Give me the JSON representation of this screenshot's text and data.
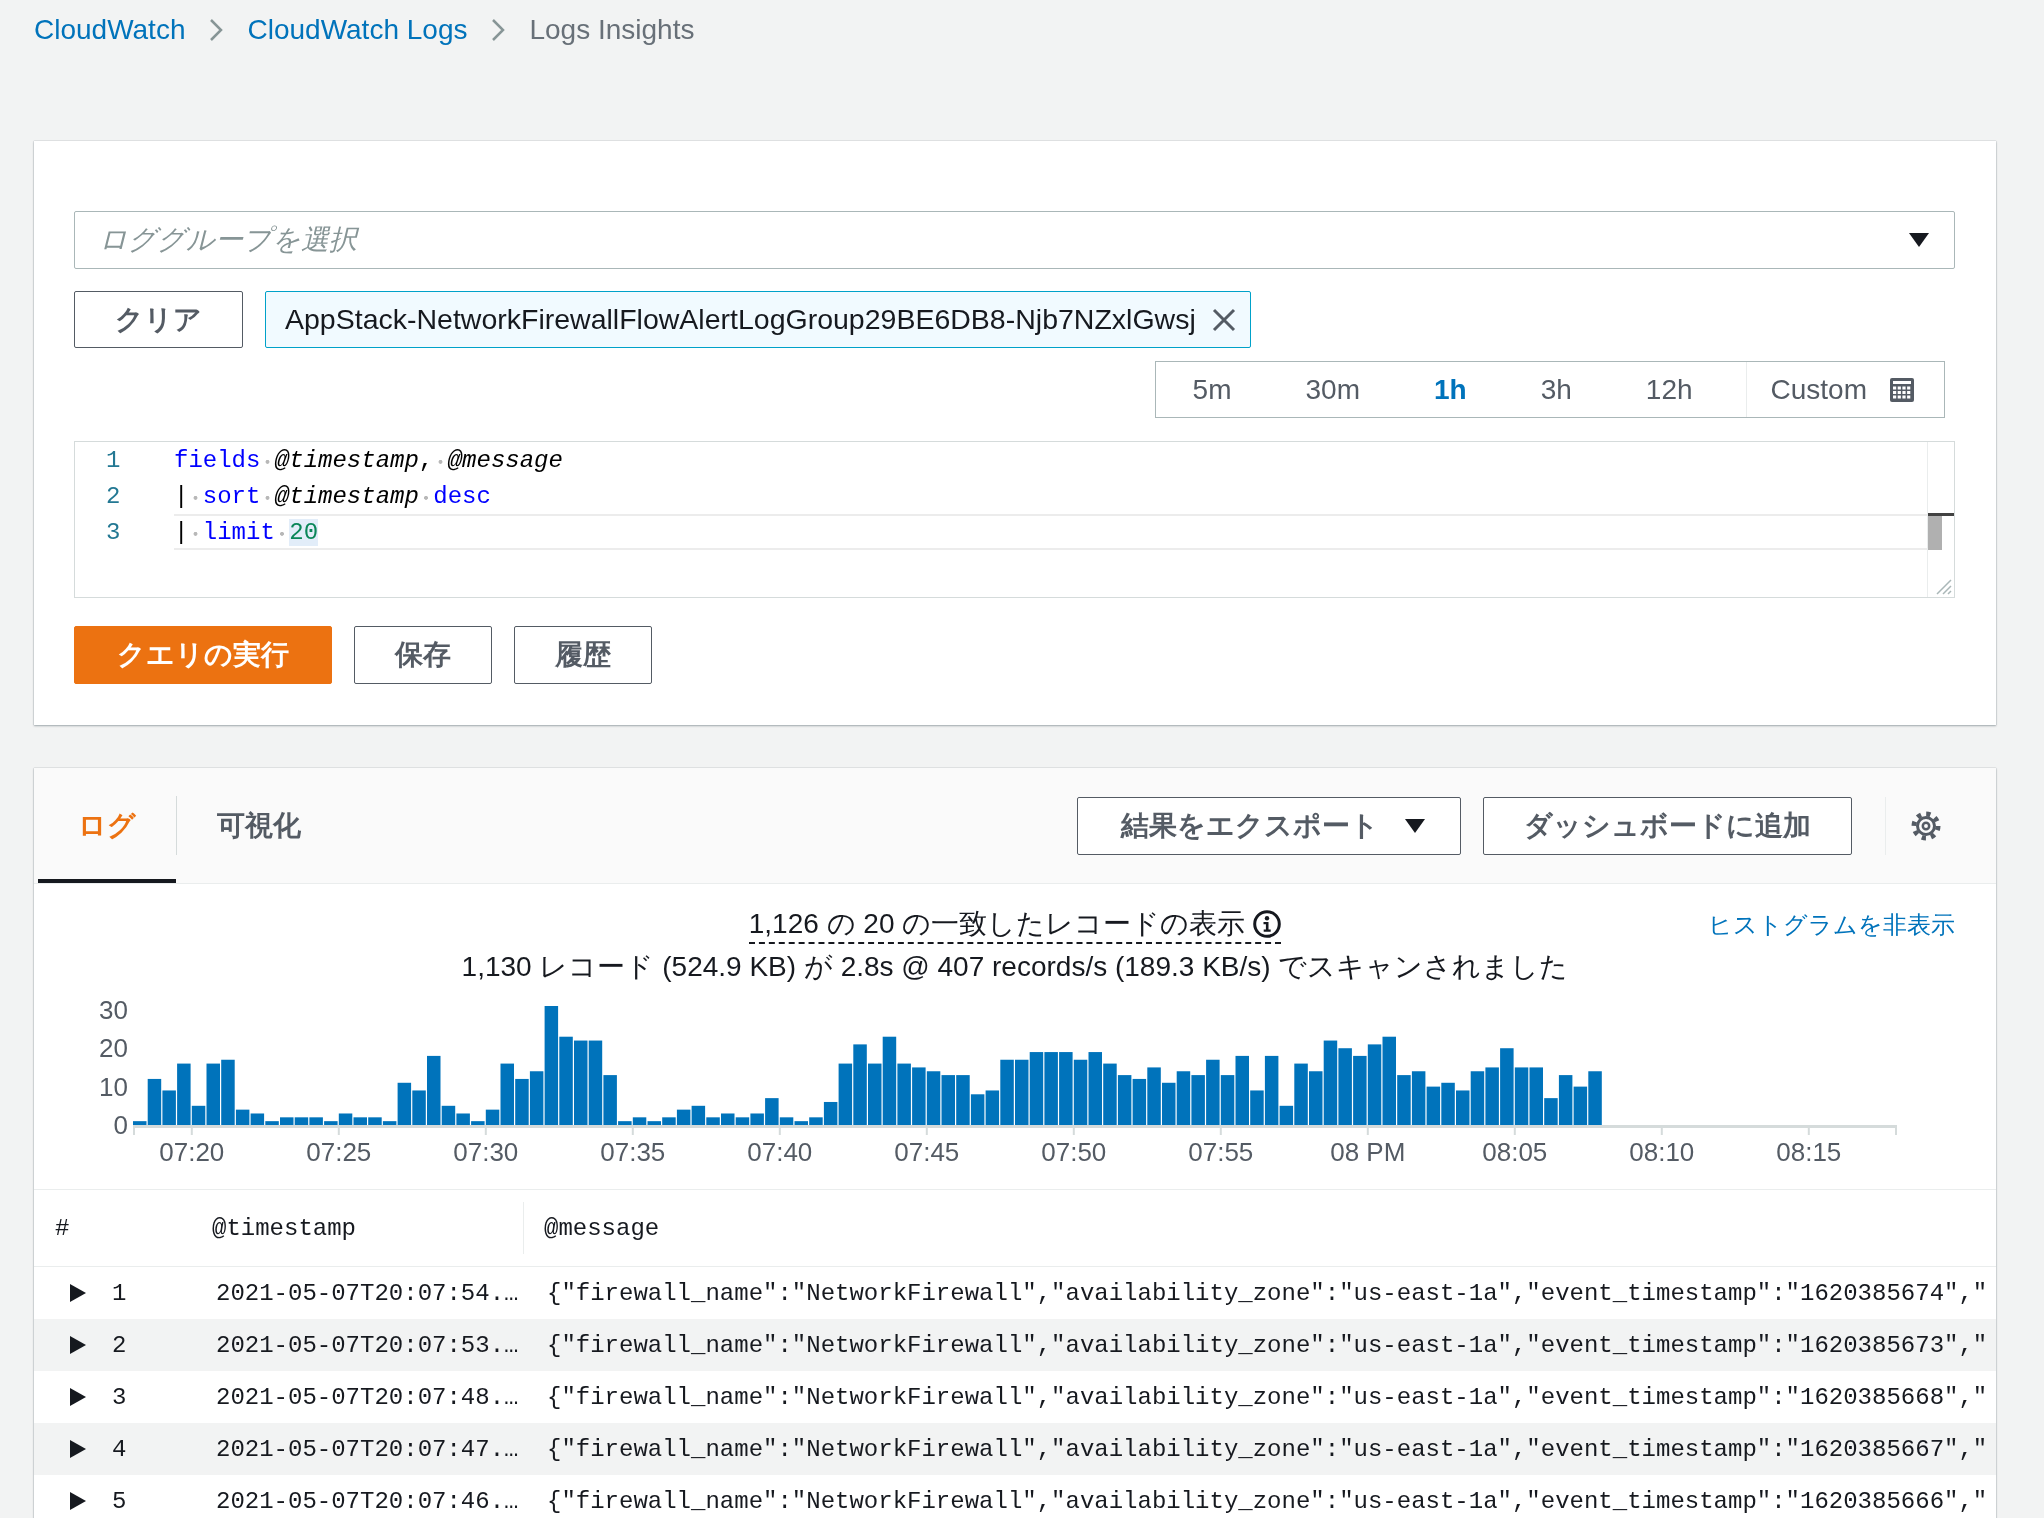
{
  "breadcrumb": [
    {
      "label": "CloudWatch",
      "kind": "link"
    },
    {
      "label": "CloudWatch Logs",
      "kind": "link"
    },
    {
      "label": "Logs Insights",
      "kind": "current"
    }
  ],
  "query_panel": {
    "log_group_select": {
      "placeholder": "ロググループを選択"
    },
    "clear_button": "クリア",
    "selected_log_groups": [
      "AppStack-NetworkFirewallFlowAlertLogGroup29BE6DB8-Njb7NZxlGwsj"
    ],
    "time_ranges": [
      {
        "label": "5m",
        "selected": false
      },
      {
        "label": "30m",
        "selected": false
      },
      {
        "label": "1h",
        "selected": true
      },
      {
        "label": "3h",
        "selected": false
      },
      {
        "label": "12h",
        "selected": false
      }
    ],
    "custom_range": {
      "label": "Custom"
    },
    "editor": {
      "lines": [
        {
          "number": "1",
          "active": false,
          "tokens": [
            {
              "kind": "keyword",
              "text": "fields ",
              "highlighted": false
            },
            {
              "kind": "field",
              "text": "@timestamp",
              "highlighted": false
            },
            {
              "kind": "punct",
              "text": ", ",
              "highlighted": false
            },
            {
              "kind": "field",
              "text": "@message",
              "highlighted": false
            }
          ]
        },
        {
          "number": "2",
          "active": false,
          "tokens": [
            {
              "kind": "punct",
              "text": "| ",
              "highlighted": false
            },
            {
              "kind": "keyword",
              "text": "sort ",
              "highlighted": false
            },
            {
              "kind": "field",
              "text": "@timestamp ",
              "highlighted": false
            },
            {
              "kind": "keyword",
              "text": "desc",
              "highlighted": false
            }
          ]
        },
        {
          "number": "3",
          "active": true,
          "tokens": [
            {
              "kind": "punct",
              "text": "| ",
              "highlighted": false
            },
            {
              "kind": "keyword",
              "text": "limit ",
              "highlighted": false
            },
            {
              "kind": "number",
              "text": "20",
              "highlighted": true
            }
          ]
        }
      ]
    },
    "buttons": [
      {
        "label": "クエリの実行",
        "kind": "primary"
      },
      {
        "label": "保存",
        "kind": "normal"
      },
      {
        "label": "履歴",
        "kind": "normal"
      }
    ]
  },
  "results_panel": {
    "tabs": [
      {
        "label": "ログ",
        "selected": true
      },
      {
        "label": "可視化",
        "selected": false
      }
    ],
    "export_button": "結果をエクスポート",
    "dashboard_button": "ダッシュボードに追加",
    "summary": "1,126 の 20 の一致したレコードの表示",
    "hide_histogram_link": "ヒストグラムを非表示",
    "scan_stats": "1,130 レコード (524.9 KB) が 2.8s @ 407 records/s (189.3 KB/s) でスキャンされました",
    "chart_data": {
      "type": "bar",
      "categories": [
        null,
        null,
        null,
        null,
        "07:20",
        null,
        null,
        null,
        null,
        null,
        null,
        null,
        null,
        null,
        "07:25",
        null,
        null,
        null,
        null,
        null,
        null,
        null,
        null,
        null,
        "07:30",
        null,
        null,
        null,
        null,
        null,
        null,
        null,
        null,
        null,
        "07:35",
        null,
        null,
        null,
        null,
        null,
        null,
        null,
        null,
        null,
        "07:40",
        null,
        null,
        null,
        null,
        null,
        null,
        null,
        null,
        null,
        "07:45",
        null,
        null,
        null,
        null,
        null,
        null,
        null,
        null,
        null,
        "07:50",
        null,
        null,
        null,
        null,
        null,
        null,
        null,
        null,
        null,
        "07:55",
        null,
        null,
        null,
        null,
        null,
        null,
        null,
        null,
        null,
        "08 PM",
        null,
        null,
        null,
        null,
        null,
        null,
        null,
        null,
        null,
        "08:05",
        null,
        null,
        null,
        null,
        null,
        null,
        null,
        null,
        null,
        "08:10",
        null,
        null,
        null,
        null,
        null,
        null,
        null,
        null,
        null,
        "08:15",
        null,
        null,
        null,
        null,
        null
      ],
      "values": [
        1,
        12,
        9,
        16,
        5,
        16,
        17,
        4,
        3,
        1,
        2,
        2,
        2,
        1,
        3,
        2,
        2,
        1,
        11,
        9,
        18,
        5,
        3,
        1,
        4,
        16,
        12,
        14,
        31,
        23,
        22,
        22,
        13,
        1,
        2,
        1,
        2,
        4,
        5,
        2,
        3,
        2,
        3,
        7,
        2,
        1,
        2,
        6,
        16,
        21,
        16,
        23,
        16,
        15,
        14,
        13,
        13,
        8,
        9,
        17,
        17,
        19,
        19,
        19,
        17,
        19,
        16,
        13,
        12,
        15,
        11,
        14,
        13,
        17,
        13,
        18,
        9,
        18,
        5,
        16,
        14,
        22,
        20,
        18,
        21,
        23,
        13,
        14,
        10,
        11,
        9,
        14,
        15,
        20,
        15,
        15,
        7,
        13,
        10,
        14,
        null,
        null,
        null,
        null,
        null,
        null,
        null,
        null,
        null,
        null,
        null,
        null,
        null,
        null,
        null,
        null,
        null,
        null,
        null,
        null
      ],
      "ylim": [
        0,
        31
      ],
      "yticks": [
        0,
        10,
        20,
        30
      ]
    },
    "table": {
      "columns": [
        "#",
        "@timestamp",
        "@message"
      ],
      "rows": [
        {
          "number": "1",
          "timestamp": "2021-05-07T20:07:54.…",
          "message": "{\"firewall_name\":\"NetworkFirewall\",\"availability_zone\":\"us-east-1a\",\"event_timestamp\":\"1620385674\",\""
        },
        {
          "number": "2",
          "timestamp": "2021-05-07T20:07:53.…",
          "message": "{\"firewall_name\":\"NetworkFirewall\",\"availability_zone\":\"us-east-1a\",\"event_timestamp\":\"1620385673\",\""
        },
        {
          "number": "3",
          "timestamp": "2021-05-07T20:07:48.…",
          "message": "{\"firewall_name\":\"NetworkFirewall\",\"availability_zone\":\"us-east-1a\",\"event_timestamp\":\"1620385668\",\""
        },
        {
          "number": "4",
          "timestamp": "2021-05-07T20:07:47.…",
          "message": "{\"firewall_name\":\"NetworkFirewall\",\"availability_zone\":\"us-east-1a\",\"event_timestamp\":\"1620385667\",\""
        },
        {
          "number": "5",
          "timestamp": "2021-05-07T20:07:46.…",
          "message": "{\"firewall_name\":\"NetworkFirewall\",\"availability_zone\":\"us-east-1a\",\"event_timestamp\":\"1620385666\",\""
        }
      ]
    }
  }
}
